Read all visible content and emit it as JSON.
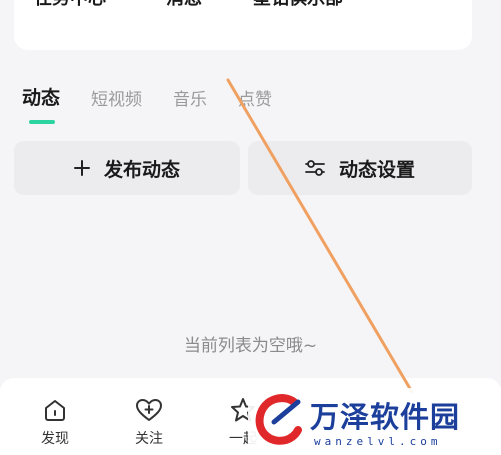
{
  "top_links": [
    "任务中心",
    "消息",
    "星钻俱乐部"
  ],
  "tabs": [
    {
      "label": "动态",
      "active": true
    },
    {
      "label": "短视频",
      "active": false
    },
    {
      "label": "音乐",
      "active": false
    },
    {
      "label": "点赞",
      "active": false
    }
  ],
  "actions": {
    "publish_label": "发布动态",
    "settings_label": "动态设置"
  },
  "empty_message": "当前列表为空哦~",
  "bottom_nav": [
    {
      "label": "发现",
      "icon": "home-icon"
    },
    {
      "label": "关注",
      "icon": "heart-plus-icon"
    },
    {
      "label": "一起",
      "icon": "star-icon"
    }
  ],
  "watermark": {
    "title": "万泽软件园",
    "url": "wanzelvl.com"
  },
  "colors": {
    "accent": "#2bd4a0",
    "annotation_line": "#f0a060",
    "watermark_blue": "#1c3f9c",
    "watermark_red": "#e0282a"
  }
}
